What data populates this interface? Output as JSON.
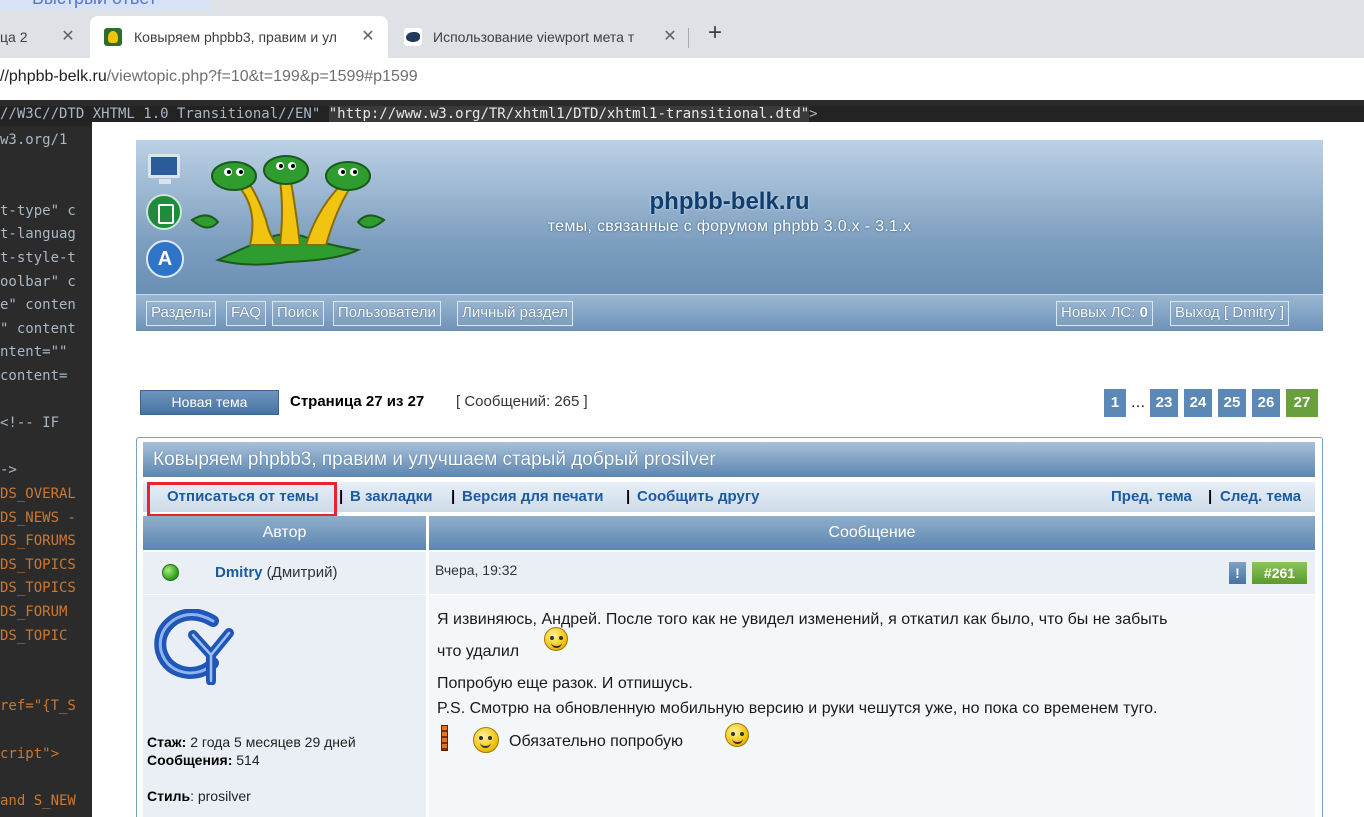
{
  "browser": {
    "top_text": "Быстрый ответ",
    "tabs": [
      {
        "title": "ца 2",
        "close": "✕"
      },
      {
        "title": "Ковыряем phpbb3, правим и ул",
        "close": "✕",
        "active": true
      },
      {
        "title": "Использование viewport мета т",
        "close": "✕"
      }
    ],
    "new_tab": "+",
    "url_host": "//phpbb-belk.ru",
    "url_path": "/viewtopic.php?f=10&t=199&p=1599#p1599"
  },
  "source": {
    "doctype_part1": "//W3C//DTD XHTML 1.0 Transitional//EN\"",
    "doctype_part2": "\"http://www.w3.org/TR/xhtml1/DTD/xhtml1-transitional.dtd\"",
    "doctype_part3": ">",
    "lines": [
      "w3.org/1",
      "",
      "",
      "t-type\" c",
      "t-languag",
      "t-style-t",
      "oolbar\" c",
      "e\" conten",
      "\" content",
      "ntent=\"\"",
      " content=",
      "",
      "<!-- IF",
      "",
      "->",
      "DS_OVERAL",
      "DS_NEWS -",
      "DS_FORUMS",
      "DS_TOPICS",
      "DS_TOPICS",
      "DS_FORUM",
      "DS_TOPIC",
      "",
      "",
      "ref=\"{T_S",
      "",
      "cript\">",
      "",
      "and S_NEW"
    ]
  },
  "forum": {
    "site_title": "phpbb-belk.ru",
    "site_description": "темы, связанные с форумом phpbb 3.0.x - 3.1.x",
    "nav_left": [
      "Разделы",
      "FAQ",
      "Поиск",
      "Пользователи",
      "Личный раздел"
    ],
    "nav_pm_label": "Новых ЛС: ",
    "nav_pm_count": "0",
    "nav_logout": "Выход [ Dmitry ]",
    "new_topic_button": "Новая тема",
    "page_info_prefix": "Страница ",
    "page_current": "27",
    "page_info_mid": " из ",
    "page_total": "27",
    "message_count": "[ Сообщений: 265 ]",
    "pagination": [
      "1",
      "…",
      "23",
      "24",
      "25",
      "26",
      "27"
    ],
    "topic_title": "Ковыряем phpbb3, правим и улучшаем старый добрый prosilver",
    "topic_actions_left": [
      "Отписаться от темы",
      "В закладки",
      "Версия для печати",
      "Сообщить другу"
    ],
    "topic_actions_right": [
      "Пред. тема",
      "След. тема"
    ],
    "action_separator": "|",
    "column_author": "Автор",
    "column_message": "Сообщение",
    "post": {
      "author_nick": "Dmitry",
      "author_real": " (Дмитрий)",
      "date": "Вчера, 19:32",
      "report": "!",
      "number": "#261",
      "profile_tenure_label": "Стаж:",
      "profile_tenure_value": " 2 года 5 месяцев 29 дней",
      "profile_posts_label": "Сообщения:",
      "profile_posts_value": " 514",
      "profile_style_label": "Стиль",
      "profile_style_value": ": prosilver",
      "body_lines": [
        "Я извиняюсь, Андрей. После того как не увидел изменений, я откатил как было, что бы не забыть",
        "что удалил",
        "Попробую еще разок. И отпишусь.",
        "P.S. Смотрю на обновленную мобильную версию и руки чешутся уже, но пока со временем туго.",
        "Обязательно попробую"
      ]
    }
  },
  "colors": {
    "highlight": "#e8232f",
    "link": "#1e5aa0",
    "active_page": "#6a9f3e",
    "page_link": "#5b88b4"
  }
}
